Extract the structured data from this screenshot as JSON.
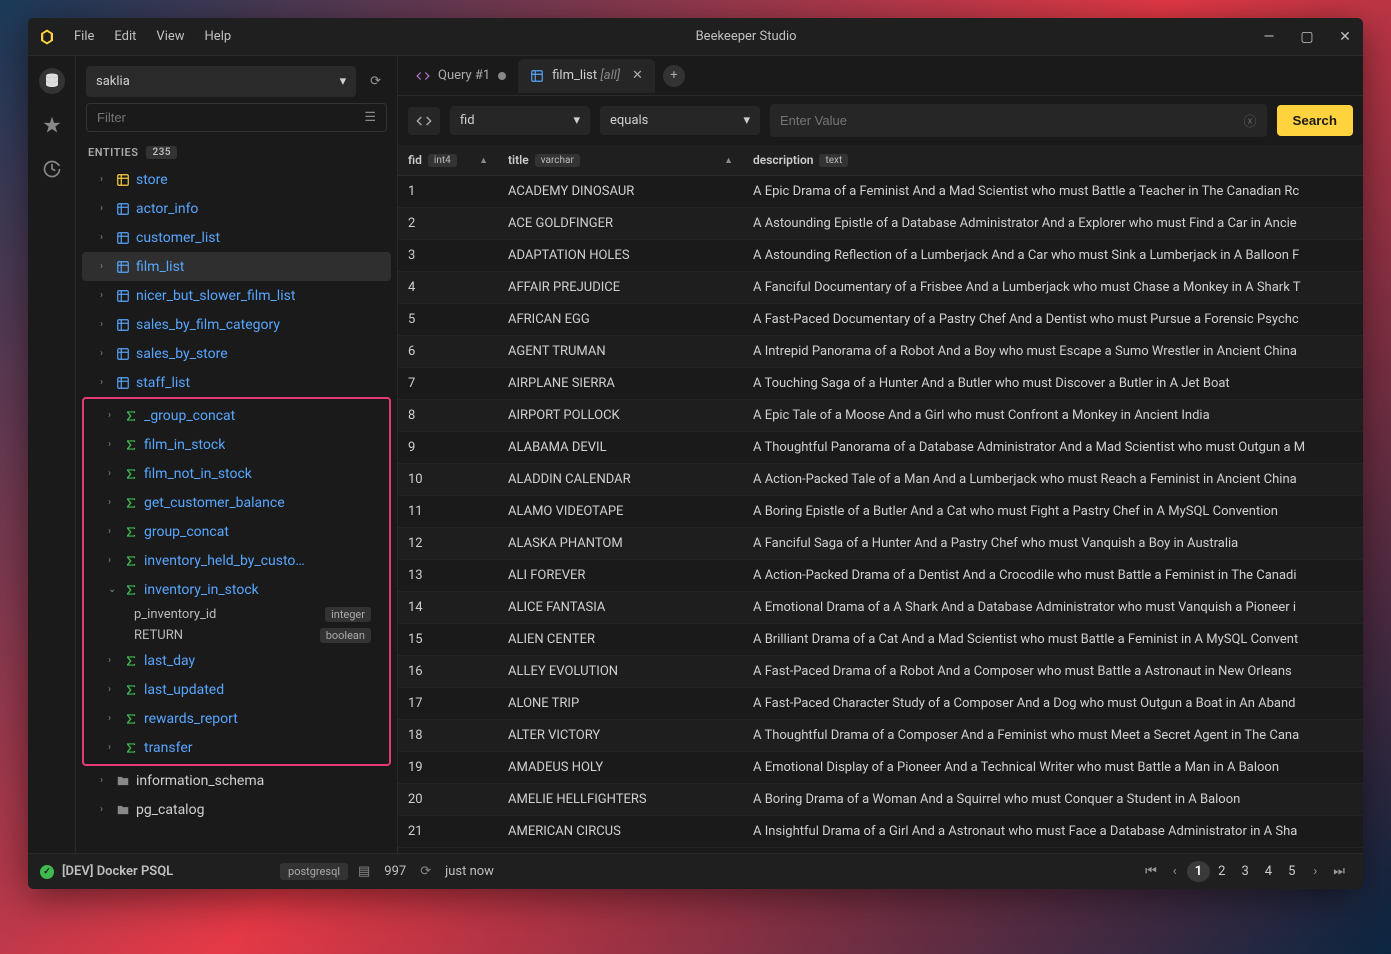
{
  "app_title": "Beekeeper Studio",
  "menu": [
    "File",
    "Edit",
    "View",
    "Help"
  ],
  "db_selector": "saklia",
  "filter_placeholder": "Filter",
  "entities_label": "ENTITIES",
  "entities_count": "235",
  "tree_tables": [
    {
      "name": "store",
      "icon": "table-yellow"
    },
    {
      "name": "actor_info",
      "icon": "table"
    },
    {
      "name": "customer_list",
      "icon": "table"
    },
    {
      "name": "film_list",
      "icon": "table",
      "selected": true
    },
    {
      "name": "nicer_but_slower_film_list",
      "icon": "table"
    },
    {
      "name": "sales_by_film_category",
      "icon": "table"
    },
    {
      "name": "sales_by_store",
      "icon": "table"
    },
    {
      "name": "staff_list",
      "icon": "table"
    }
  ],
  "tree_funcs": [
    {
      "name": "_group_concat"
    },
    {
      "name": "film_in_stock"
    },
    {
      "name": "film_not_in_stock"
    },
    {
      "name": "get_customer_balance"
    },
    {
      "name": "group_concat"
    },
    {
      "name": "inventory_held_by_custo…"
    },
    {
      "name": "inventory_in_stock",
      "expanded": true,
      "params": [
        {
          "name": "p_inventory_id",
          "type": "integer"
        },
        {
          "name": "RETURN",
          "type": "boolean"
        }
      ]
    },
    {
      "name": "last_day"
    },
    {
      "name": "last_updated"
    },
    {
      "name": "rewards_report"
    },
    {
      "name": "transfer"
    }
  ],
  "tree_schemas": [
    {
      "name": "information_schema"
    },
    {
      "name": "pg_catalog"
    }
  ],
  "tabs": [
    {
      "label": "Query #1",
      "icon": "code",
      "dirty": true
    },
    {
      "label": "film_list",
      "suffix": "[all]",
      "icon": "table",
      "active": true
    }
  ],
  "filter_col": "fid",
  "filter_op": "equals",
  "filter_value_placeholder": "Enter Value",
  "search_label": "Search",
  "columns": [
    {
      "name": "fid",
      "type": "int4"
    },
    {
      "name": "title",
      "type": "varchar"
    },
    {
      "name": "description",
      "type": "text"
    }
  ],
  "rows": [
    {
      "fid": "1",
      "title": "ACADEMY DINOSAUR",
      "desc": "A Epic Drama of a Feminist And a Mad Scientist who must Battle a Teacher in The Canadian Rc"
    },
    {
      "fid": "2",
      "title": "ACE GOLDFINGER",
      "desc": "A Astounding Epistle of a Database Administrator And a Explorer who must Find a Car in Ancie"
    },
    {
      "fid": "3",
      "title": "ADAPTATION HOLES",
      "desc": "A Astounding Reflection of a Lumberjack And a Car who must Sink a Lumberjack in A Balloon F"
    },
    {
      "fid": "4",
      "title": "AFFAIR PREJUDICE",
      "desc": "A Fanciful Documentary of a Frisbee And a Lumberjack who must Chase a Monkey in A Shark T"
    },
    {
      "fid": "5",
      "title": "AFRICAN EGG",
      "desc": "A Fast-Paced Documentary of a Pastry Chef And a Dentist who must Pursue a Forensic Psychc"
    },
    {
      "fid": "6",
      "title": "AGENT TRUMAN",
      "desc": "A Intrepid Panorama of a Robot And a Boy who must Escape a Sumo Wrestler in Ancient China"
    },
    {
      "fid": "7",
      "title": "AIRPLANE SIERRA",
      "desc": "A Touching Saga of a Hunter And a Butler who must Discover a Butler in A Jet Boat"
    },
    {
      "fid": "8",
      "title": "AIRPORT POLLOCK",
      "desc": "A Epic Tale of a Moose And a Girl who must Confront a Monkey in Ancient India"
    },
    {
      "fid": "9",
      "title": "ALABAMA DEVIL",
      "desc": "A Thoughtful Panorama of a Database Administrator And a Mad Scientist who must Outgun a M"
    },
    {
      "fid": "10",
      "title": "ALADDIN CALENDAR",
      "desc": "A Action-Packed Tale of a Man And a Lumberjack who must Reach a Feminist in Ancient China"
    },
    {
      "fid": "11",
      "title": "ALAMO VIDEOTAPE",
      "desc": "A Boring Epistle of a Butler And a Cat who must Fight a Pastry Chef in A MySQL Convention"
    },
    {
      "fid": "12",
      "title": "ALASKA PHANTOM",
      "desc": "A Fanciful Saga of a Hunter And a Pastry Chef who must Vanquish a Boy in Australia"
    },
    {
      "fid": "13",
      "title": "ALI FOREVER",
      "desc": "A Action-Packed Drama of a Dentist And a Crocodile who must Battle a Feminist in The Canadi"
    },
    {
      "fid": "14",
      "title": "ALICE FANTASIA",
      "desc": "A Emotional Drama of a A Shark And a Database Administrator who must Vanquish a Pioneer i"
    },
    {
      "fid": "15",
      "title": "ALIEN CENTER",
      "desc": "A Brilliant Drama of a Cat And a Mad Scientist who must Battle a Feminist in A MySQL Convent"
    },
    {
      "fid": "16",
      "title": "ALLEY EVOLUTION",
      "desc": "A Fast-Paced Drama of a Robot And a Composer who must Battle a Astronaut in New Orleans"
    },
    {
      "fid": "17",
      "title": "ALONE TRIP",
      "desc": "A Fast-Paced Character Study of a Composer And a Dog who must Outgun a Boat in An Aband"
    },
    {
      "fid": "18",
      "title": "ALTER VICTORY",
      "desc": "A Thoughtful Drama of a Composer And a Feminist who must Meet a Secret Agent in The Cana"
    },
    {
      "fid": "19",
      "title": "AMADEUS HOLY",
      "desc": "A Emotional Display of a Pioneer And a Technical Writer who must Battle a Man in A Baloon"
    },
    {
      "fid": "20",
      "title": "AMELIE HELLFIGHTERS",
      "desc": "A Boring Drama of a Woman And a Squirrel who must Conquer a Student in A Baloon"
    },
    {
      "fid": "21",
      "title": "AMERICAN CIRCUS",
      "desc": "A Insightful Drama of a Girl And a Astronaut who must Face a Database Administrator in A Sha"
    }
  ],
  "status_conn": "[DEV] Docker PSQL",
  "status_dbtype": "postgresql",
  "row_count": "997",
  "last_run": "just now",
  "pages": [
    "1",
    "2",
    "3",
    "4",
    "5"
  ]
}
